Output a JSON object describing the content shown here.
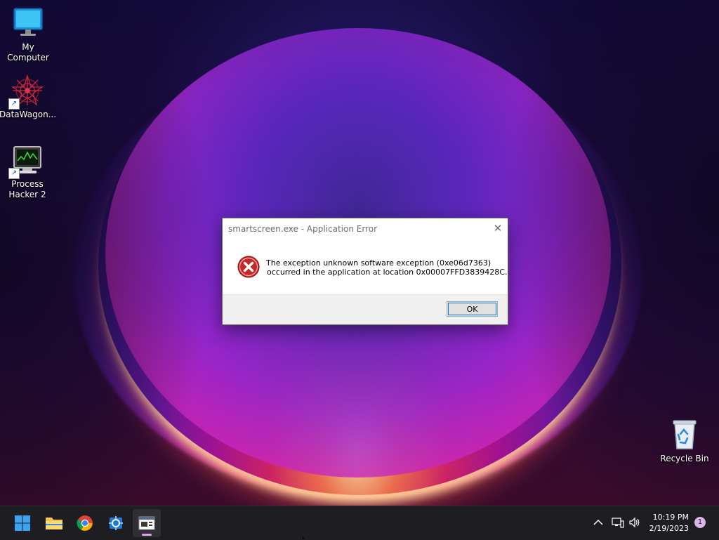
{
  "desktop": {
    "icons": [
      {
        "label": "My Computer",
        "icon": "monitor-icon"
      },
      {
        "label": "DataWagon...",
        "icon": "datawagon-icon"
      },
      {
        "label": "Process Hacker 2",
        "icon": "process-hacker-icon"
      },
      {
        "label": "Recycle Bin",
        "icon": "recycle-bin-icon"
      }
    ]
  },
  "dialog": {
    "title": "smartscreen.exe - Application Error",
    "message_line1": "The exception unknown software exception (0xe06d7363)",
    "message_line2": "occurred in the application at location 0x00007FFD3839428C.",
    "ok_label": "OK",
    "icon": "error-icon"
  },
  "taskbar": {
    "apps": [
      {
        "name": "Start",
        "icon": "windows-start-icon"
      },
      {
        "name": "File Explorer",
        "icon": "folder-icon"
      },
      {
        "name": "Google Chrome",
        "icon": "chrome-icon"
      },
      {
        "name": "Process Monitor",
        "icon": "process-monitor-icon"
      },
      {
        "name": "Application window",
        "icon": "app-window-icon",
        "active": true
      }
    ],
    "tray": {
      "time": "10:19 PM",
      "date": "2/19/2023",
      "notification_count": "1"
    }
  },
  "colors": {
    "accent": "#0078d7",
    "error_red": "#c62828",
    "taskbar_bg": "#1e1e22",
    "indicator": "#e0a6df"
  }
}
